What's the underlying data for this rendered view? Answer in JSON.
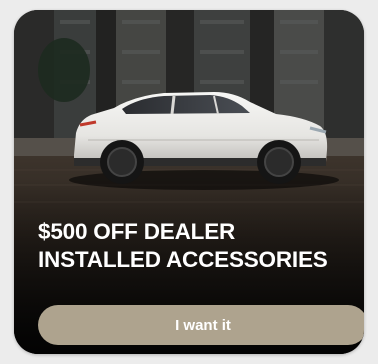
{
  "promo": {
    "headline_line1": "$500 OFF DEALER",
    "headline_line2": "INSTALLED ACCESSORIES",
    "cta_label": "I want it",
    "image_icon": "white-suv-photo"
  },
  "colors": {
    "card_background": "#151412",
    "button_background": "#aea38e",
    "text": "#ffffff",
    "page_background": "#ececec"
  }
}
